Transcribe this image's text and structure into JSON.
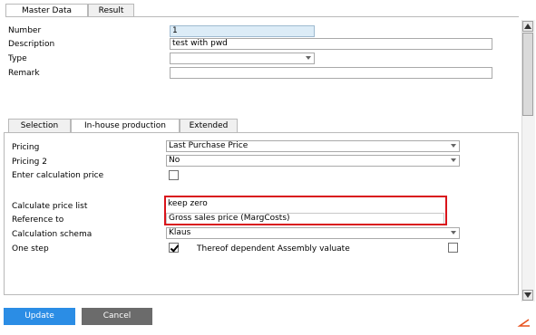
{
  "top_tabs": [
    {
      "label": "Master Data",
      "active": true
    },
    {
      "label": "Result",
      "active": false
    }
  ],
  "master": {
    "number_label": "Number",
    "number_value": "1",
    "description_label": "Description",
    "description_value": "test with pwd",
    "type_label": "Type",
    "type_value": "",
    "remark_label": "Remark",
    "remark_value": ""
  },
  "sub_tabs": [
    {
      "label": "Selection",
      "active": false
    },
    {
      "label": "In-house production",
      "active": true
    },
    {
      "label": "Extended",
      "active": false
    }
  ],
  "inhouse": {
    "pricing_label": "Pricing",
    "pricing_value": "Last Purchase Price",
    "pricing2_label": "Pricing 2",
    "pricing2_value": "No",
    "enter_calc_label": "Enter calculation price",
    "enter_calc_checked": false,
    "calc_price_list_label": "Calculate price list",
    "calc_price_list_value": "keep zero",
    "reference_label": "Reference to",
    "reference_value": "Gross sales price (MargCosts)",
    "calc_schema_label": "Calculation schema",
    "calc_schema_value": "Klaus",
    "one_step_label": "One step",
    "one_step_checked": true,
    "dependent_label": "Thereof dependent Assembly valuate",
    "dependent_checked": false
  },
  "buttons": {
    "update_label": "Update",
    "cancel_label": "Cancel"
  },
  "colors": {
    "highlight_border": "#d9141b",
    "update_bg": "#2b8de5",
    "cancel_bg": "#6b6b6b",
    "accent": "#e8521d"
  }
}
